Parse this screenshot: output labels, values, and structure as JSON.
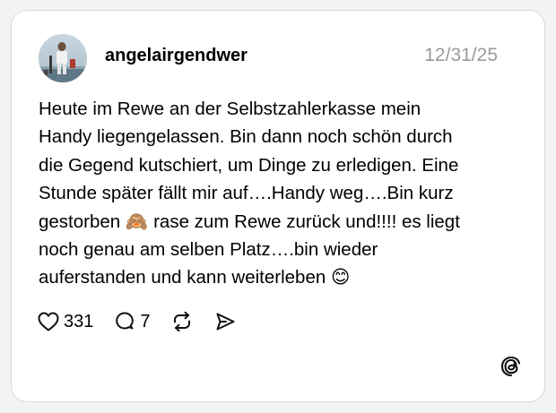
{
  "post": {
    "username": "angelairgendwer",
    "date": "12/31/25",
    "text": "Heute im Rewe an der Selbstzahlerkasse mein\nHandy liegengelassen. Bin dann noch schön durch\ndie Gegend kutschiert, um Dinge zu erledigen. Eine\nStunde später fällt mir auf….Handy weg….Bin kurz\ngestorben 🙈 rase zum Rewe zurück und!!!! es liegt\nnoch genau am selben Platz….bin wieder\nauferstanden und kann weiterleben 😊"
  },
  "actions": {
    "likes": "331",
    "replies": "7",
    "icons": [
      "heart-icon",
      "reply-icon",
      "repost-icon",
      "share-icon"
    ]
  },
  "brand": {
    "logo": "threads-logo-icon"
  },
  "colors": {
    "background": "#f3f3f3",
    "card": "#ffffff",
    "date": "#9a9a9a",
    "text": "#000000"
  }
}
